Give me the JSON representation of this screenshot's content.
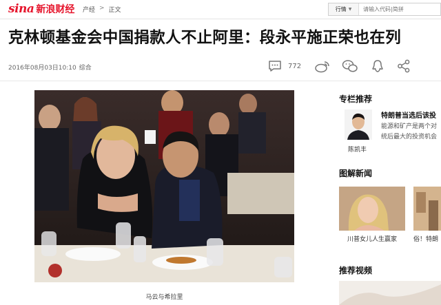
{
  "header": {
    "logo_text": "sina",
    "logo_cn": "新浪财经",
    "breadcrumb": [
      "产经",
      "正文"
    ],
    "breadcrumb_sep": ">",
    "search_select": "行情",
    "search_placeholder": "请输入代码|简拼"
  },
  "article": {
    "title": "克林顿基金会中国捐款人不止阿里：段永平施正荣也在列",
    "datetime": "2016年08月03日10:10",
    "source": "综合",
    "comment_count": "772",
    "photo_caption": "马云与希拉里"
  },
  "sidebar": {
    "column_title": "专栏推荐",
    "column_headline": "特朗普当选后该投",
    "column_summary": [
      "能源和矿产是两个对",
      "统后最大的投资机会"
    ],
    "column_author": "陈凯丰",
    "image_news_title": "图解新闻",
    "image_news": [
      {
        "caption": "川普女儿人生赢家"
      },
      {
        "caption": "俗！特朗"
      }
    ],
    "video_title": "推荐视频"
  },
  "colors": {
    "brand_red": "#e6162d",
    "text_dark": "#111111",
    "meta_gray": "#666666"
  },
  "icons": [
    "comment-icon",
    "share-weibo-icon",
    "wechat-icon",
    "qq-icon",
    "share-icon",
    "chevron-down-icon"
  ]
}
